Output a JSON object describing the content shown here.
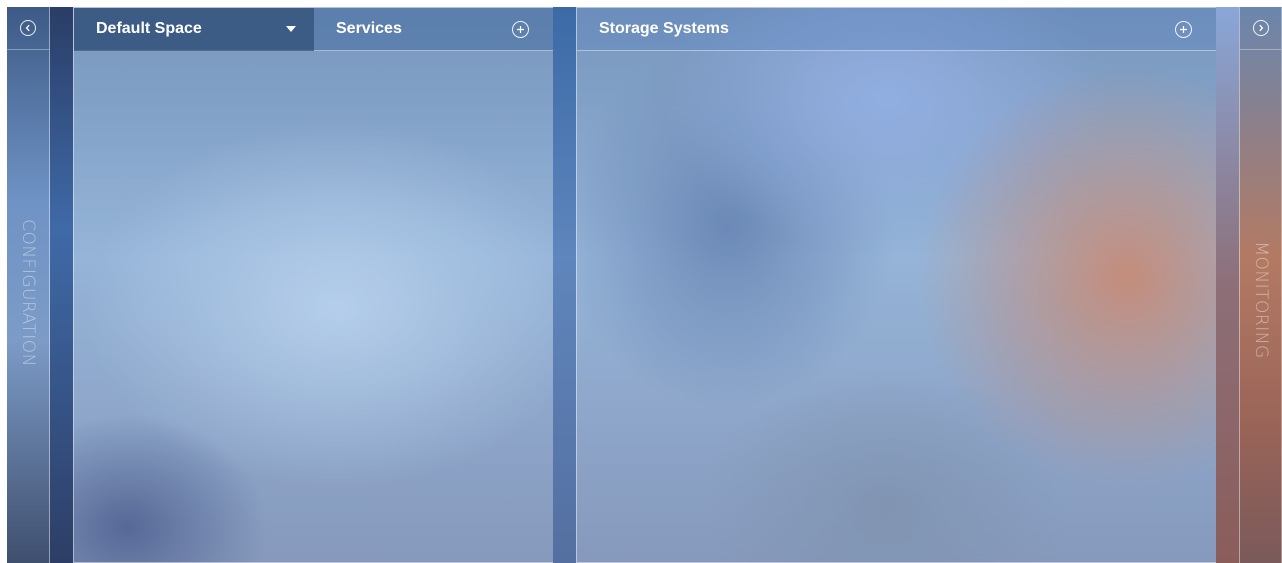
{
  "left_rail": {
    "label": "CONFIGURATION",
    "toggle_icon": "chevron-left-circle-icon"
  },
  "right_rail": {
    "label": "MONITORING",
    "toggle_icon": "chevron-right-circle-icon"
  },
  "services_panel": {
    "space_select": "Default Space",
    "title": "Services",
    "add_icon": "plus-circle-icon"
  },
  "storage_panel": {
    "title": "Storage Systems",
    "add_icon": "plus-circle-icon"
  },
  "colors": {
    "text": "#ffffff",
    "header_dark": "#32507a"
  }
}
